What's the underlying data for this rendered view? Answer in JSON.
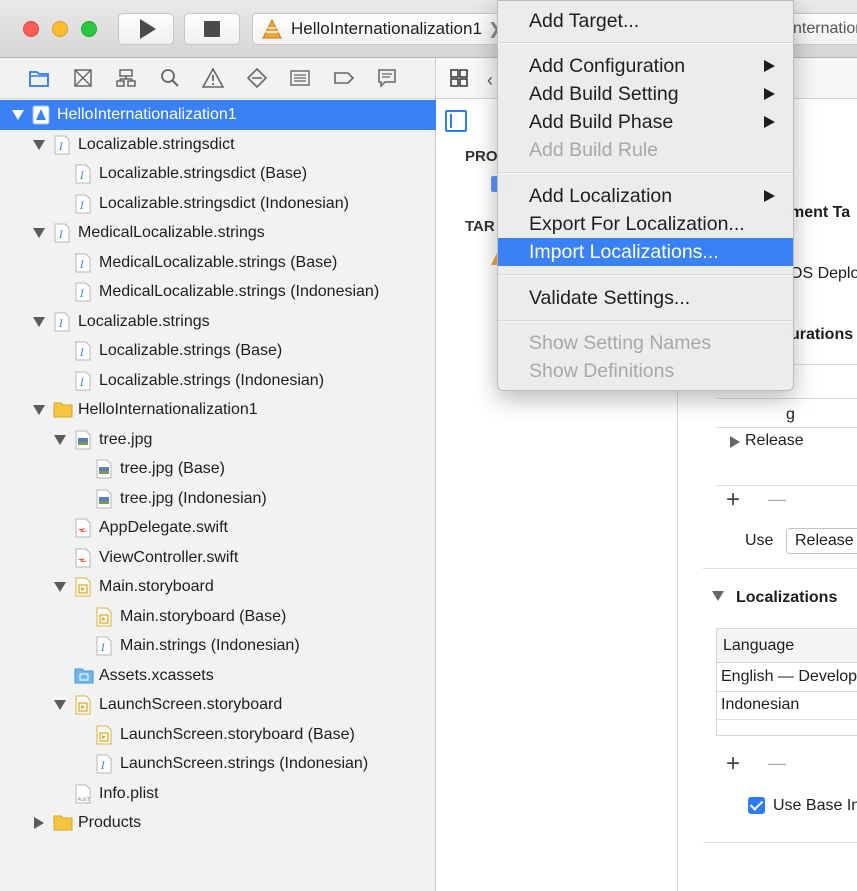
{
  "toolbar": {
    "scheme_name": "HelloInternationalization1",
    "scheme_separator": "❯",
    "destination_fragment": "nternation"
  },
  "navigator": {
    "tabs": [
      "folder-icon",
      "source-control-icon",
      "hierarchy-icon",
      "search-icon",
      "warning-icon",
      "test-icon",
      "debug-icon",
      "breakpoint-icon",
      "report-icon"
    ],
    "items": [
      {
        "label": "HelloInternationalization1",
        "depth": 0,
        "disclosure": "open",
        "icon": "project-icon",
        "selected": true
      },
      {
        "label": "Localizable.stringsdict",
        "depth": 1,
        "disclosure": "open",
        "icon": "strings-file-icon"
      },
      {
        "label": "Localizable.stringsdict (Base)",
        "depth": 2,
        "disclosure": "none",
        "icon": "strings-file-icon"
      },
      {
        "label": "Localizable.stringsdict (Indonesian)",
        "depth": 2,
        "disclosure": "none",
        "icon": "strings-file-icon"
      },
      {
        "label": "MedicalLocalizable.strings",
        "depth": 1,
        "disclosure": "open",
        "icon": "strings-file-icon"
      },
      {
        "label": "MedicalLocalizable.strings (Base)",
        "depth": 2,
        "disclosure": "none",
        "icon": "strings-file-icon"
      },
      {
        "label": "MedicalLocalizable.strings (Indonesian)",
        "depth": 2,
        "disclosure": "none",
        "icon": "strings-file-icon"
      },
      {
        "label": "Localizable.strings",
        "depth": 1,
        "disclosure": "open",
        "icon": "strings-file-icon"
      },
      {
        "label": "Localizable.strings (Base)",
        "depth": 2,
        "disclosure": "none",
        "icon": "strings-file-icon"
      },
      {
        "label": "Localizable.strings (Indonesian)",
        "depth": 2,
        "disclosure": "none",
        "icon": "strings-file-icon"
      },
      {
        "label": "HelloInternationalization1",
        "depth": 1,
        "disclosure": "open",
        "icon": "folder-icon"
      },
      {
        "label": "tree.jpg",
        "depth": 2,
        "disclosure": "open",
        "icon": "image-file-icon"
      },
      {
        "label": "tree.jpg (Base)",
        "depth": 3,
        "disclosure": "none",
        "icon": "image-file-icon"
      },
      {
        "label": "tree.jpg (Indonesian)",
        "depth": 3,
        "disclosure": "none",
        "icon": "image-file-icon"
      },
      {
        "label": "AppDelegate.swift",
        "depth": 2,
        "disclosure": "none",
        "icon": "swift-file-icon"
      },
      {
        "label": "ViewController.swift",
        "depth": 2,
        "disclosure": "none",
        "icon": "swift-file-icon"
      },
      {
        "label": "Main.storyboard",
        "depth": 2,
        "disclosure": "open",
        "icon": "storyboard-file-icon"
      },
      {
        "label": "Main.storyboard (Base)",
        "depth": 3,
        "disclosure": "none",
        "icon": "storyboard-file-icon"
      },
      {
        "label": "Main.strings (Indonesian)",
        "depth": 3,
        "disclosure": "none",
        "icon": "strings-file-icon"
      },
      {
        "label": "Assets.xcassets",
        "depth": 2,
        "disclosure": "none",
        "icon": "assets-folder-icon"
      },
      {
        "label": "LaunchScreen.storyboard",
        "depth": 2,
        "disclosure": "open",
        "icon": "storyboard-file-icon"
      },
      {
        "label": "LaunchScreen.storyboard (Base)",
        "depth": 3,
        "disclosure": "none",
        "icon": "storyboard-file-icon"
      },
      {
        "label": "LaunchScreen.strings (Indonesian)",
        "depth": 3,
        "disclosure": "none",
        "icon": "strings-file-icon"
      },
      {
        "label": "Info.plist",
        "depth": 2,
        "disclosure": "none",
        "icon": "plist-file-icon"
      },
      {
        "label": "Products",
        "depth": 1,
        "disclosure": "closed",
        "icon": "folder-icon"
      }
    ]
  },
  "editor": {
    "project_header": "PRO",
    "targets_header": "TAR",
    "deployment_target_fragment": "ment Ta",
    "ios_deploy_fragment": "OS Deplo",
    "configurations_fragment": "urations",
    "config_debug_fragment": "g",
    "config_release": "Release",
    "use_label": "Use",
    "use_value": "Release",
    "localizations_title": "Localizations",
    "language_column": "Language",
    "languages": [
      "English — Develop",
      "Indonesian"
    ],
    "use_base_label": "Use Base In",
    "plus": "+",
    "minus": "—"
  },
  "context_menu": {
    "items": [
      {
        "label": "Add Target...",
        "enabled": true,
        "submenu": false
      },
      {
        "label": "Add Configuration",
        "enabled": true,
        "submenu": true
      },
      {
        "label": "Add Build Setting",
        "enabled": true,
        "submenu": true
      },
      {
        "label": "Add Build Phase",
        "enabled": true,
        "submenu": true
      },
      {
        "label": "Add Build Rule",
        "enabled": false,
        "submenu": false
      },
      {
        "label": "Add Localization",
        "enabled": true,
        "submenu": true
      },
      {
        "label": "Export For Localization...",
        "enabled": true,
        "submenu": false
      },
      {
        "label": "Import Localizations...",
        "enabled": true,
        "submenu": false,
        "highlighted": true
      },
      {
        "label": "Validate Settings...",
        "enabled": true,
        "submenu": false
      },
      {
        "label": "Show Setting Names",
        "enabled": false,
        "submenu": false
      },
      {
        "label": "Show Definitions",
        "enabled": false,
        "submenu": false
      }
    ]
  },
  "colors": {
    "selection": "#3a80f7",
    "toolbar_bg": "#dcdcdc",
    "sidebar_bg": "#f2f2f2",
    "menu_bg": "#ececec"
  }
}
